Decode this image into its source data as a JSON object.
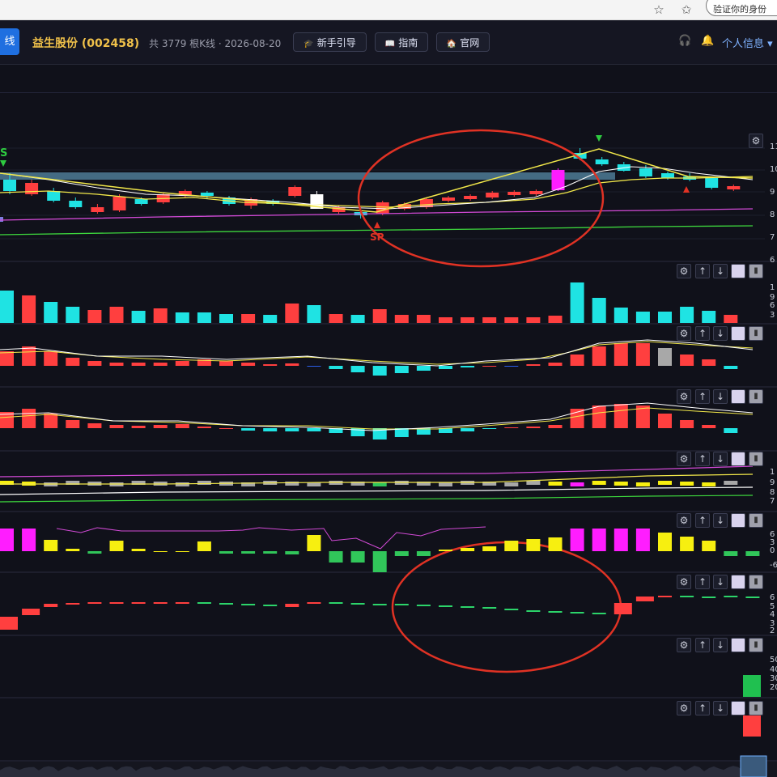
{
  "browser": {
    "verify_label": "验证你的身份",
    "star_icon": "star-icon",
    "favorites_icon": "favorites-icon"
  },
  "header": {
    "left_tab_label": "线",
    "stock": "益生股份 (002458)",
    "meta": "共 3779 根K线 · 2026-08-20",
    "buttons": [
      {
        "icon": "graduation-icon",
        "label": "新手引导"
      },
      {
        "icon": "book-icon",
        "label": "指南"
      },
      {
        "icon": "home-icon",
        "label": "官网"
      }
    ],
    "user_label": "个人信息"
  },
  "colors": {
    "bg": "#10111a",
    "up": "#ff3f3f",
    "down": "#1fe3e3",
    "ma_yellow": "#f2e84a",
    "ma_white": "#ffffff",
    "ma_magenta": "#d24ad6",
    "ma_green": "#3dd63d",
    "annotation": "#e03224",
    "ma_grey": "#a8a8a8",
    "magenta_bar": "#ff1dff",
    "yellow_bar": "#f7ef10",
    "green_bar": "#31c65a",
    "dash_green": "#2cd46a",
    "blue_bar": "#2a5ee8"
  },
  "price_axis_labels": [
    "11",
    "10",
    "9",
    "8",
    "7",
    "6"
  ],
  "signals": {
    "buy_label": "S",
    "sp_label": "SP"
  },
  "volume_axis_labels": [
    "1",
    "9",
    "6",
    "3"
  ],
  "panel4_axis_labels": [
    "1",
    "9",
    "8",
    "7"
  ],
  "panel5_axis_labels": [
    "6",
    "3",
    "0",
    "-6"
  ],
  "panel6_axis_labels": [
    "6",
    "5",
    "4",
    "3",
    "2"
  ],
  "panel7_axis_labels": [
    "50",
    "40",
    "30",
    "20"
  ],
  "panel_controls": {
    "settings": "settings-icon",
    "up": "arrow-up-icon",
    "down": "arrow-down-icon",
    "color": "color-swatch-icon",
    "delete": "delete-icon"
  }
}
